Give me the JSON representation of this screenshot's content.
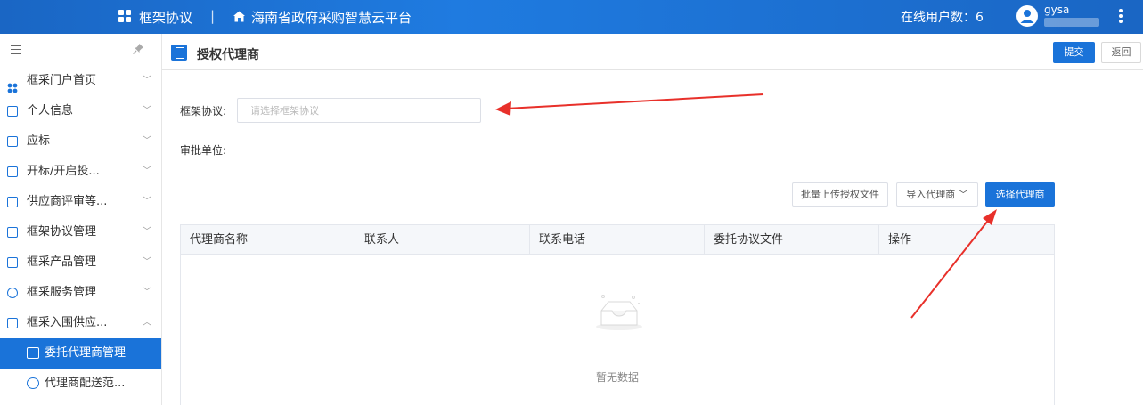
{
  "topbar": {
    "brand": "框架协议",
    "separator": "|",
    "platform": "海南省政府采购智慧云平台",
    "online_users": "在线用户数：6",
    "username": "gysa"
  },
  "sidebar": {
    "items": [
      {
        "label": "框采门户首页",
        "arrow": "﹀"
      },
      {
        "label": "个人信息",
        "arrow": "﹀"
      },
      {
        "label": "应标",
        "arrow": "﹀"
      },
      {
        "label": "开标/开启投...",
        "arrow": "﹀"
      },
      {
        "label": "供应商评审等...",
        "arrow": "﹀"
      },
      {
        "label": "框架协议管理",
        "arrow": "﹀"
      },
      {
        "label": "框采产品管理",
        "arrow": "﹀"
      },
      {
        "label": "框采服务管理",
        "arrow": "﹀"
      },
      {
        "label": "框采入围供应...",
        "arrow": "︿"
      }
    ],
    "subitems": [
      {
        "label": "委托代理商管理",
        "active": true
      },
      {
        "label": "代理商配送范...",
        "active": false
      }
    ]
  },
  "page": {
    "title": "授权代理商",
    "submit_label": "提交",
    "back_label": "返回"
  },
  "form": {
    "framework_label": "框架协议:",
    "framework_placeholder": "请选择框架协议",
    "framework_value": "",
    "approval_label": "审批单位:"
  },
  "toolbar": {
    "upload_label": "批量上传授权文件",
    "import_label": "导入代理商 ﹀",
    "select_label": "选择代理商"
  },
  "table": {
    "columns": [
      "代理商名称",
      "联系人",
      "联系电话",
      "委托协议文件",
      "操作"
    ],
    "empty_text": "暂无数据"
  },
  "colors": {
    "primary": "#1a73d9",
    "annotation_arrow": "#e8302a"
  }
}
